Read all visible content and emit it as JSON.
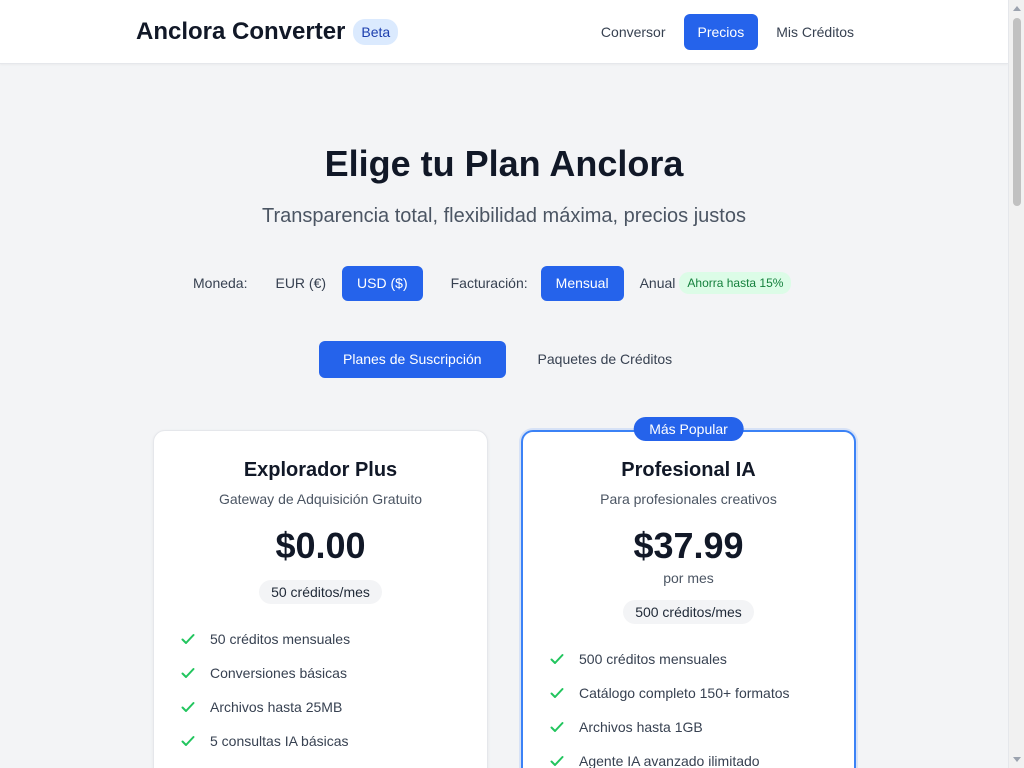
{
  "header": {
    "title": "Anclora Converter",
    "badge": "Beta",
    "nav": [
      {
        "label": "Conversor",
        "active": false
      },
      {
        "label": "Precios",
        "active": true
      },
      {
        "label": "Mis Créditos",
        "active": false
      }
    ]
  },
  "hero": {
    "title": "Elige tu Plan Anclora",
    "subtitle": "Transparencia total, flexibilidad máxima, precios justos"
  },
  "controls": {
    "currency_label": "Moneda:",
    "currency_options": [
      "EUR (€)",
      "USD ($)"
    ],
    "currency_selected": "USD ($)",
    "billing_label": "Facturación:",
    "billing_options": [
      "Mensual",
      "Anual"
    ],
    "billing_selected": "Mensual",
    "annual_badge": "Ahorra hasta 15%"
  },
  "tabs": [
    {
      "label": "Planes de Suscripción",
      "active": true
    },
    {
      "label": "Paquetes de Créditos",
      "active": false
    }
  ],
  "plans": [
    {
      "name": "Explorador Plus",
      "description": "Gateway de Adquisición Gratuito",
      "price": "$0.00",
      "period": "",
      "credits": "50 créditos/mes",
      "popular": false,
      "features": [
        "50 créditos mensuales",
        "Conversiones básicas",
        "Archivos hasta 25MB",
        "5 consultas IA básicas"
      ]
    },
    {
      "name": "Profesional IA",
      "description": "Para profesionales creativos",
      "price": "$37.99",
      "period": "por mes",
      "credits": "500 créditos/mes",
      "popular": true,
      "popular_label": "Más Popular",
      "features": [
        "500 créditos mensuales",
        "Catálogo completo 150+ formatos",
        "Archivos hasta 1GB",
        "Agente IA avanzado ilimitado"
      ]
    }
  ],
  "colors": {
    "accent": "#2563eb",
    "check": "#22c55e",
    "badge_green_bg": "#dcfce7",
    "badge_green_text": "#15803d"
  },
  "icons": {
    "feature_check": "check-icon"
  }
}
